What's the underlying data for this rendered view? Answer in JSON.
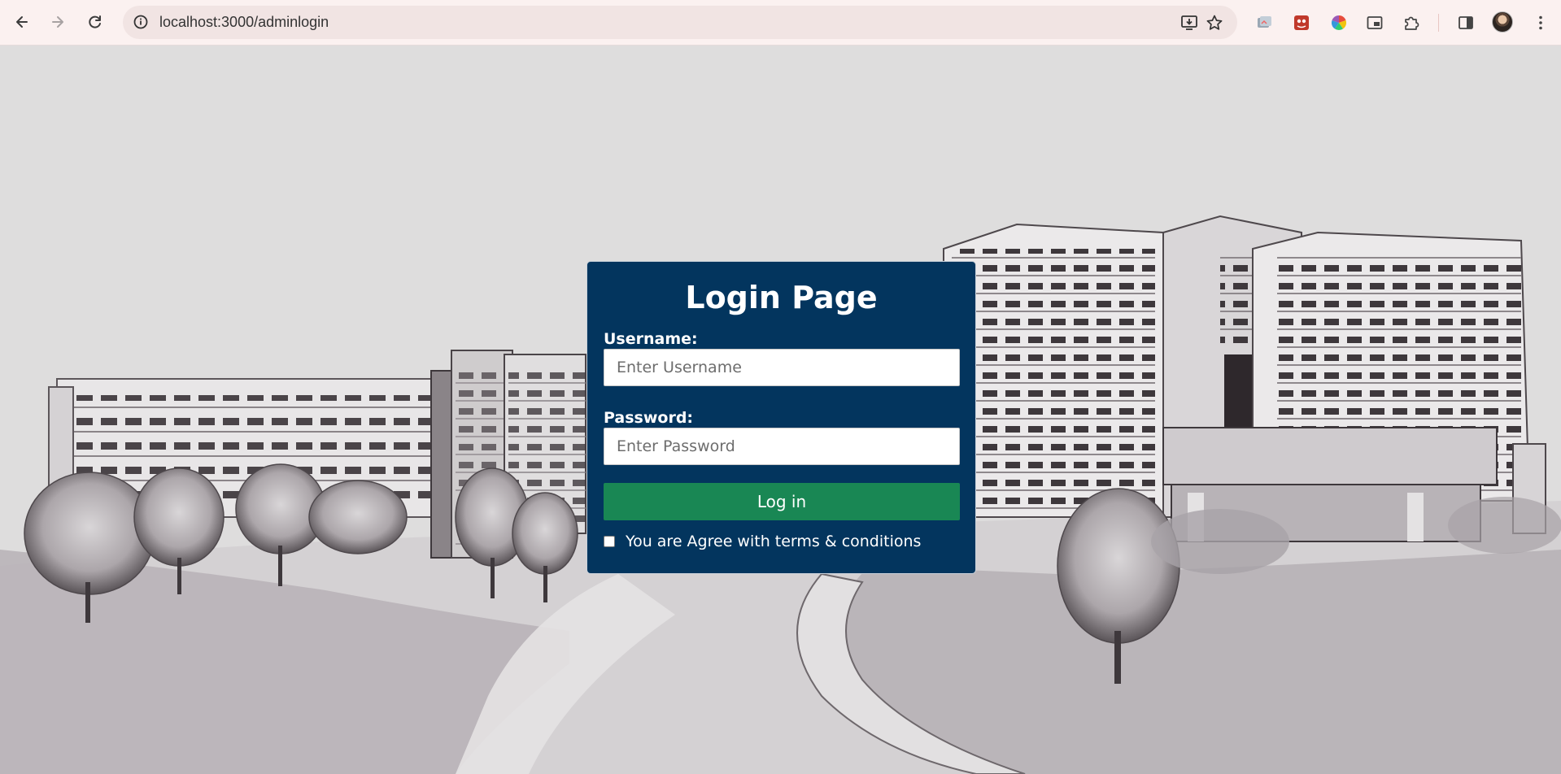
{
  "browser": {
    "url": "localhost:3000/adminlogin",
    "back_icon": "arrow-left",
    "forward_icon": "arrow-right",
    "reload_icon": "reload",
    "site_info_icon": "info-circle",
    "install_icon": "install-app",
    "bookmark_icon": "star",
    "extensions": [
      "extension-1",
      "extension-2",
      "extension-color-wheel",
      "picture-in-picture",
      "puzzle-extensions"
    ],
    "side_panel_icon": "side-panel",
    "menu_icon": "three-dots"
  },
  "login": {
    "title": "Login Page",
    "username_label": "Username:",
    "username_placeholder": "Enter Username",
    "username_value": "",
    "password_label": "Password:",
    "password_placeholder": "Enter Password",
    "password_value": "",
    "login_button": "Log in",
    "terms_label": "You are Agree with terms & conditions",
    "terms_checked": false
  },
  "colors": {
    "card_bg": "#03355e",
    "button_bg": "#198754",
    "chrome_bg": "#fbf1f0",
    "page_bg": "#dedddd"
  }
}
